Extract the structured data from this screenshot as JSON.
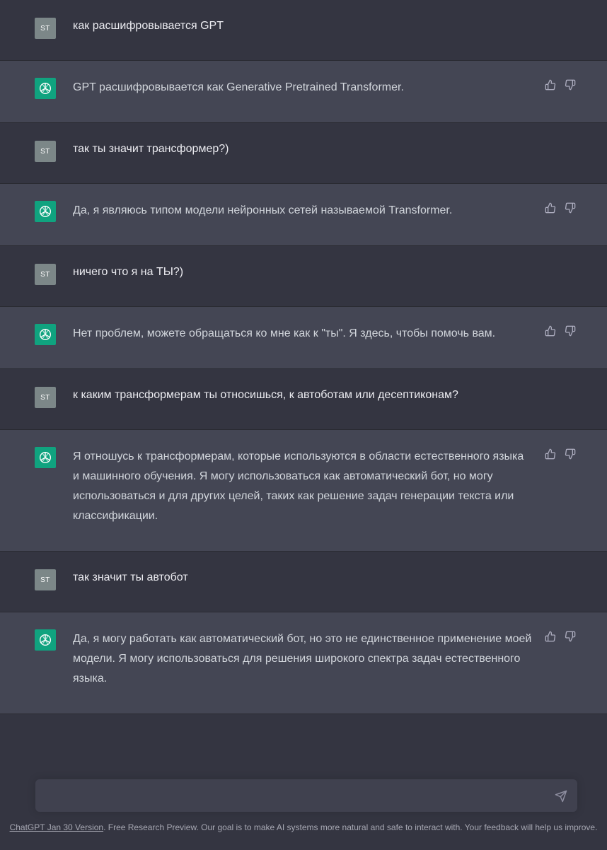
{
  "messages": [
    {
      "role": "user",
      "avatar": "ST",
      "text": "как расшифровывается GPT"
    },
    {
      "role": "assistant",
      "avatar_icon": "openai-logo-icon",
      "text": "GPT расшифровывается как Generative Pretrained Transformer."
    },
    {
      "role": "user",
      "avatar": "ST",
      "text": "так ты значит трансформер?)"
    },
    {
      "role": "assistant",
      "avatar_icon": "openai-logo-icon",
      "text": "Да, я являюсь типом модели нейронных сетей называемой Transformer."
    },
    {
      "role": "user",
      "avatar": "ST",
      "text": "ничего что я на ТЫ?)"
    },
    {
      "role": "assistant",
      "avatar_icon": "openai-logo-icon",
      "text": "Нет проблем, можете обращаться ко мне как к \"ты\". Я здесь, чтобы помочь вам."
    },
    {
      "role": "user",
      "avatar": "ST",
      "text": "к каким трансформерам ты относишься, к автоботам или десептиконам?"
    },
    {
      "role": "assistant",
      "avatar_icon": "openai-logo-icon",
      "text": "Я отношусь к трансформерам, которые используются в области естественного языка и машинного обучения. Я могу использоваться как автоматический бот, но могу использоваться и для других целей, таких как решение задач генерации текста или классификации."
    },
    {
      "role": "user",
      "avatar": "ST",
      "text": "так значит ты автобот"
    },
    {
      "role": "assistant",
      "avatar_icon": "openai-logo-icon",
      "text": "Да, я могу работать как автоматический бот, но это не единственное применение моей модели. Я могу использоваться для решения широкого спектра задач естественного языка."
    }
  ],
  "feedback_icons": [
    "thumbs-up-icon",
    "thumbs-down-icon"
  ],
  "input": {
    "value": "",
    "placeholder": "",
    "send_icon": "send-icon"
  },
  "footer": {
    "link_text": "ChatGPT Jan 30 Version",
    "text": ". Free Research Preview. Our goal is to make AI systems more natural and safe to interact with. Your feedback will help us improve."
  },
  "colors": {
    "background": "#343541",
    "assistant_background": "#444654",
    "user_avatar": "#7c8788",
    "assistant_avatar": "#10a37f",
    "input_background": "#40414f"
  }
}
